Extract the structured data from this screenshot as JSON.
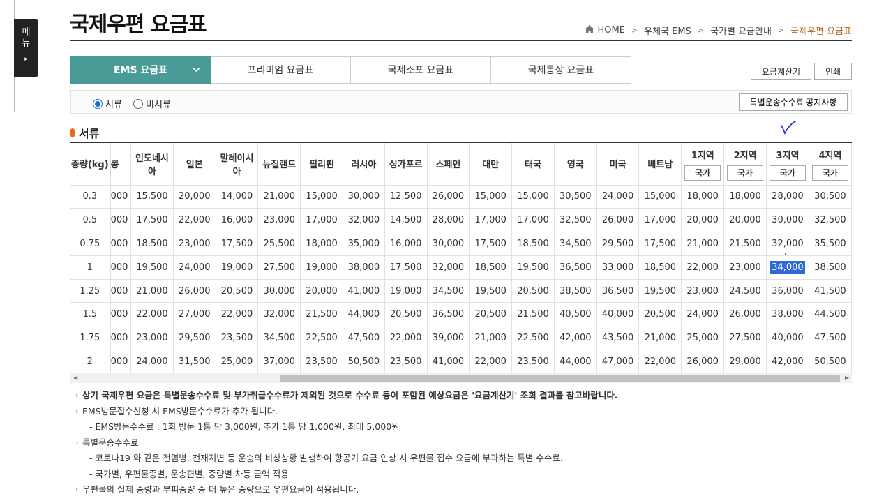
{
  "side_menu": {
    "label_1": "메",
    "label_2": "뉴",
    "arrow": "▸"
  },
  "page": {
    "title": "국제우편 요금표"
  },
  "breadcrumb": [
    "HOME",
    "우체국 EMS",
    "국가별 요금안내",
    "국제우편 요금표"
  ],
  "tabs": [
    {
      "label": "EMS 요금표",
      "active": true
    },
    {
      "label": "프리미엄 요금표",
      "active": false
    },
    {
      "label": "국제소포 요금표",
      "active": false
    },
    {
      "label": "국제통상 요금표",
      "active": false
    }
  ],
  "buttons": {
    "calculator": "요금계산기",
    "print": "인쇄",
    "notice": "특별운송수수료 공지사항"
  },
  "radios": [
    {
      "label": "서류",
      "checked": true
    },
    {
      "label": "비서류",
      "checked": false
    }
  ],
  "section": {
    "title": "서류"
  },
  "table": {
    "first_header": "중량(kg)",
    "columns": [
      "콩",
      "인도네시아",
      "일본",
      "말레이시아",
      "뉴질랜드",
      "필리핀",
      "러시아",
      "싱가포르",
      "스페인",
      "대만",
      "태국",
      "영국",
      "미국",
      "베트남"
    ],
    "zones": [
      "1지역",
      "2지역",
      "3지역",
      "4지역"
    ],
    "zone_button": "국가",
    "rows": [
      {
        "w": "0.3",
        "v": [
          "000",
          "15,500",
          "20,000",
          "14,000",
          "21,000",
          "15,000",
          "30,000",
          "12,500",
          "26,000",
          "15,000",
          "15,000",
          "30,500",
          "24,000",
          "15,000",
          "18,000",
          "18,000",
          "28,000",
          "30,500"
        ]
      },
      {
        "w": "0.5",
        "v": [
          "000",
          "17,500",
          "22,000",
          "16,000",
          "23,000",
          "17,000",
          "32,000",
          "14,500",
          "28,000",
          "17,000",
          "17,000",
          "32,500",
          "26,000",
          "17,000",
          "20,000",
          "20,000",
          "30,000",
          "32,500"
        ]
      },
      {
        "w": "0.75",
        "v": [
          "000",
          "18,500",
          "23,000",
          "17,500",
          "25,500",
          "18,000",
          "35,000",
          "16,000",
          "30,000",
          "17,500",
          "18,500",
          "34,500",
          "29,500",
          "17,500",
          "21,000",
          "21,500",
          "32,000",
          "35,500"
        ]
      },
      {
        "w": "1",
        "v": [
          "000",
          "19,500",
          "24,000",
          "19,000",
          "27,500",
          "19,000",
          "38,000",
          "17,500",
          "32,000",
          "18,500",
          "19,500",
          "36,500",
          "33,000",
          "18,500",
          "22,000",
          "23,000",
          "34,000",
          "38,500"
        ]
      },
      {
        "w": "1.25",
        "v": [
          "000",
          "21,000",
          "26,000",
          "20,500",
          "30,000",
          "20,000",
          "41,000",
          "19,000",
          "34,500",
          "19,500",
          "20,500",
          "38,500",
          "36,500",
          "19,500",
          "23,000",
          "24,500",
          "36,000",
          "41,500"
        ]
      },
      {
        "w": "1.5",
        "v": [
          "000",
          "22,000",
          "27,000",
          "22,000",
          "32,000",
          "21,500",
          "44,000",
          "20,500",
          "36,500",
          "20,500",
          "21,500",
          "40,500",
          "40,000",
          "20,500",
          "24,000",
          "26,000",
          "38,000",
          "44,500"
        ]
      },
      {
        "w": "1.75",
        "v": [
          "000",
          "23,000",
          "29,500",
          "23,500",
          "34,500",
          "22,500",
          "47,500",
          "22,000",
          "39,000",
          "21,000",
          "22,500",
          "42,000",
          "43,500",
          "21,000",
          "25,000",
          "27,500",
          "40,000",
          "47,500"
        ]
      },
      {
        "w": "2",
        "v": [
          "000",
          "24,000",
          "31,500",
          "25,000",
          "37,000",
          "23,500",
          "50,500",
          "23,500",
          "41,000",
          "22,000",
          "23,500",
          "44,000",
          "47,000",
          "22,000",
          "26,000",
          "29,000",
          "42,000",
          "50,500"
        ]
      }
    ],
    "highlight": {
      "row": 3,
      "col": 16
    }
  },
  "notes": [
    {
      "text": "상기 국제우편 요금은 특별운송수수료 및 부가취급수수료가 제외된 것으로 수수료 등이 포함된 예상요금은 '요금계산기' 조회 결과를 참고바랍니다.",
      "bullet": true,
      "bold": true
    },
    {
      "text": "EMS방문접수신청 시 EMS방문수수료가 추가 됩니다.",
      "bullet": true,
      "bold": false
    },
    {
      "text": "- EMS방문수수료 : 1회 방문 1통 당 3,000원, 추가 1통 당 1,000원, 최대 5,000원",
      "bullet": false,
      "bold": false
    },
    {
      "text": "특별운송수수료",
      "bullet": true,
      "bold": false
    },
    {
      "text": "- 코로나19 와 같은 전염병, 천재지변 등 운송의 비상상황 발생하여 항공기 요금 인상 시 우편물 접수 요금에 부과하는 특별 수수료.",
      "bullet": false,
      "bold": false
    },
    {
      "text": "- 국가별, 우편물종별, 운송편별, 중량별 차등 금액 적용",
      "bullet": false,
      "bold": false
    },
    {
      "text": "우편물의 실제 중량과 부피중량 중 더 높은 중량으로 우편요금이 적용됩니다.",
      "bullet": true,
      "bold": false
    }
  ],
  "colors": {
    "tab_active": "#4a9a98",
    "accent_orange": "#e36c1b",
    "breadcrumb_current": "#b5651d",
    "highlight": "#2f6ad8"
  }
}
